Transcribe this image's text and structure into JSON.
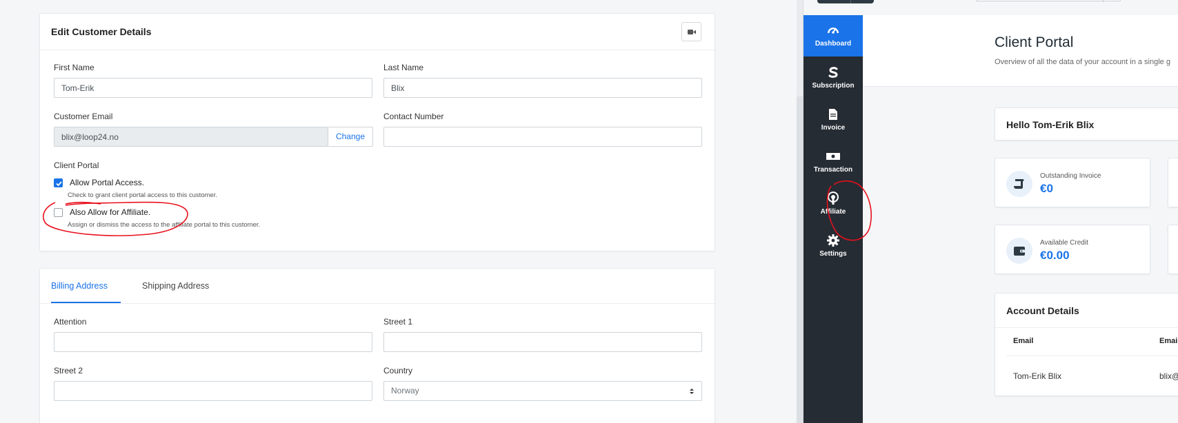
{
  "edit_form": {
    "title": "Edit Customer Details",
    "first_name": {
      "label": "First Name",
      "value": "Tom-Erik"
    },
    "last_name": {
      "label": "Last Name",
      "value": "Blix"
    },
    "email": {
      "label": "Customer Email",
      "value": "blix@loop24.no",
      "change_label": "Change"
    },
    "contact": {
      "label": "Contact Number",
      "value": ""
    },
    "client_portal": {
      "label": "Client Portal",
      "allow_portal": {
        "label": "Allow Portal Access.",
        "help": "Check to grant client portal access to this customer.",
        "checked": true
      },
      "allow_affiliate": {
        "label": "Also Allow for Affiliate.",
        "help": "Assign or dismiss the access to the affiliate portal to this customer.",
        "checked": false
      }
    }
  },
  "address": {
    "tabs": [
      {
        "label": "Billing Address",
        "active": true
      },
      {
        "label": "Shipping Address",
        "active": false
      }
    ],
    "attention": {
      "label": "Attention",
      "value": ""
    },
    "street1": {
      "label": "Street 1",
      "value": ""
    },
    "street2": {
      "label": "Street 2",
      "value": ""
    },
    "country": {
      "label": "Country",
      "value": "Norway"
    }
  },
  "portal": {
    "sidebar": [
      {
        "label": "Dashboard",
        "icon": "dashboard-icon",
        "active": true
      },
      {
        "label": "Subscription",
        "icon": "subscription-icon",
        "active": false
      },
      {
        "label": "Invoice",
        "icon": "invoice-icon",
        "active": false
      },
      {
        "label": "Transaction",
        "icon": "transaction-icon",
        "active": false
      },
      {
        "label": "Affiliate",
        "icon": "affiliate-icon",
        "active": false
      },
      {
        "label": "Settings",
        "icon": "gear-icon",
        "active": false
      }
    ],
    "title": "Client Portal",
    "subtitle": "Overview of all the data of your account in a single g",
    "greeting": "Hello Tom-Erik Blix",
    "outstanding": {
      "label": "Outstanding Invoice",
      "value": "€0"
    },
    "credit": {
      "label": "Available Credit",
      "value": "€0.00"
    },
    "account": {
      "title": "Account Details",
      "headers": [
        "Email",
        "Email"
      ],
      "row": [
        "Tom-Erik Blix",
        "blix@l"
      ]
    }
  },
  "colors": {
    "primary": "#1a73e8",
    "sidebar": "#262c33",
    "annotation": "#e8101c"
  }
}
